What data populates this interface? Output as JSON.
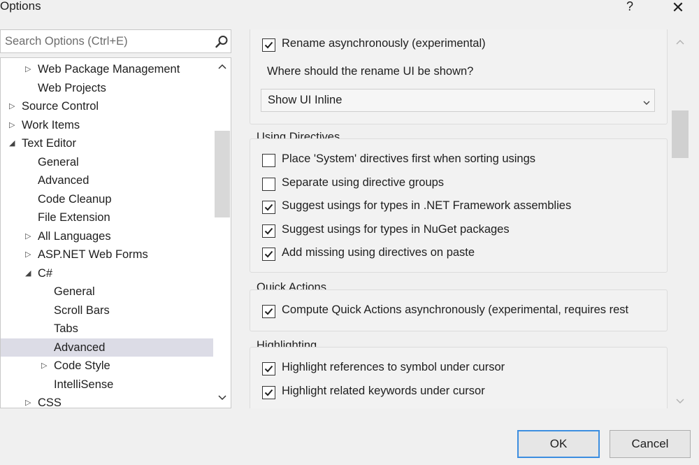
{
  "window": {
    "title": "Options",
    "help_label": "?",
    "close_label": "✕"
  },
  "search": {
    "placeholder": "Search Options (Ctrl+E)"
  },
  "tree": [
    {
      "label": "Web Package Management",
      "arrow": "▷",
      "level": 1
    },
    {
      "label": "Web Projects",
      "arrow": "",
      "level": 1
    },
    {
      "label": "Source Control",
      "arrow": "▷",
      "level": 0
    },
    {
      "label": "Work Items",
      "arrow": "▷",
      "level": 0
    },
    {
      "label": "Text Editor",
      "arrow": "◢",
      "level": 0
    },
    {
      "label": "General",
      "arrow": "",
      "level": 1
    },
    {
      "label": "Advanced",
      "arrow": "",
      "level": 1
    },
    {
      "label": "Code Cleanup",
      "arrow": "",
      "level": 1
    },
    {
      "label": "File Extension",
      "arrow": "",
      "level": 1
    },
    {
      "label": "All Languages",
      "arrow": "▷",
      "level": 1
    },
    {
      "label": "ASP.NET Web Forms",
      "arrow": "▷",
      "level": 1
    },
    {
      "label": "C#",
      "arrow": "◢",
      "level": 1
    },
    {
      "label": "General",
      "arrow": "",
      "level": 2
    },
    {
      "label": "Scroll Bars",
      "arrow": "",
      "level": 2
    },
    {
      "label": "Tabs",
      "arrow": "",
      "level": 2
    },
    {
      "label": "Advanced",
      "arrow": "",
      "level": 2,
      "selected": true
    },
    {
      "label": "Code Style",
      "arrow": "▷",
      "level": 2
    },
    {
      "label": "IntelliSense",
      "arrow": "",
      "level": 2
    },
    {
      "label": "CSS",
      "arrow": "▷",
      "level": 1
    }
  ],
  "rename": {
    "async_label": "Rename asynchronously (experimental)",
    "async_checked": true,
    "where_label": "Where should the rename UI be shown?",
    "ui_location_value": "Show UI Inline"
  },
  "using_directives": {
    "title": "Using Directives",
    "options": [
      {
        "label": "Place 'System' directives first when sorting usings",
        "checked": false
      },
      {
        "label": "Separate using directive groups",
        "checked": false
      },
      {
        "label": "Suggest usings for types in .NET Framework assemblies",
        "checked": true
      },
      {
        "label": "Suggest usings for types in NuGet packages",
        "checked": true
      },
      {
        "label": "Add missing using directives on paste",
        "checked": true
      }
    ]
  },
  "quick_actions": {
    "title": "Quick Actions",
    "options": [
      {
        "label": "Compute Quick Actions asynchronously (experimental, requires rest",
        "checked": true
      }
    ]
  },
  "highlighting": {
    "title": "Highlighting",
    "options": [
      {
        "label": "Highlight references to symbol under cursor",
        "checked": true
      },
      {
        "label": "Highlight related keywords under cursor",
        "checked": true
      }
    ]
  },
  "buttons": {
    "ok": "OK",
    "cancel": "Cancel"
  }
}
